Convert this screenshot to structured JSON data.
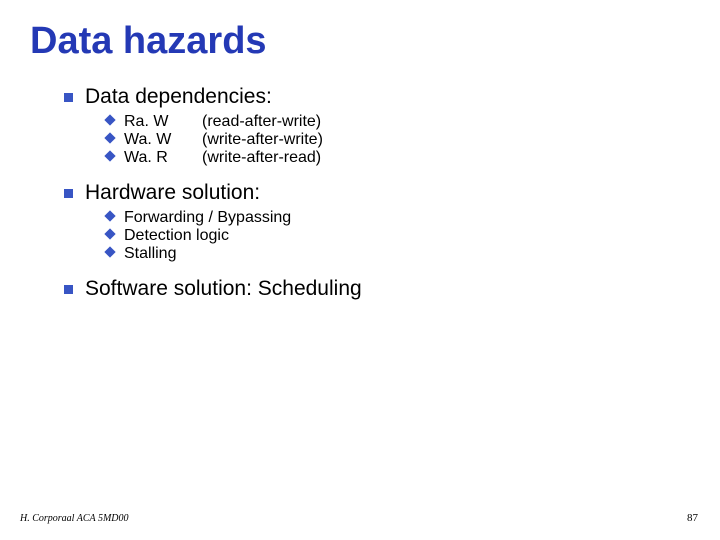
{
  "title": "Data hazards",
  "sections": [
    {
      "label": "Data dependencies:",
      "items": [
        {
          "col1": "Ra. W",
          "col2": "(read-after-write)"
        },
        {
          "col1": "Wa. W",
          "col2": "(write-after-write)"
        },
        {
          "col1": "Wa. R",
          "col2": "(write-after-read)"
        }
      ]
    },
    {
      "label": "Hardware solution:",
      "items": [
        {
          "col1": "Forwarding / Bypassing"
        },
        {
          "col1": "Detection logic"
        },
        {
          "col1": "Stalling"
        }
      ]
    },
    {
      "label": "Software solution: Scheduling"
    }
  ],
  "footer": "H. Corporaal   ACA 5MD00",
  "pagenum": "87"
}
